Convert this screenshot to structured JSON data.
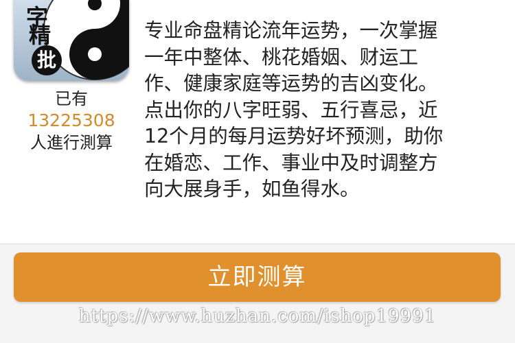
{
  "app_icon": {
    "chars": [
      "字",
      "精"
    ],
    "badge": "批",
    "icon": "yin-yang-icon"
  },
  "stats": {
    "prefix": "已有",
    "count": "13225308",
    "suffix": "人進行測算"
  },
  "description": {
    "lines": [
      "专业命盘精论流年运势，一次掌握",
      "一年中整体、桃花婚姻、财运工",
      "作、健康家庭等运势的吉凶变化。",
      "点出你的八字旺弱、五行喜忌，近",
      "12个月的每月运势好坏预测，助你",
      "在婚恋、工作、事业中及时调整方",
      "向大展身手，如鱼得水。"
    ]
  },
  "cta": {
    "label": "立即测算"
  },
  "watermark": {
    "text": "https://www.huzhan.com/ishop19991"
  },
  "colors": {
    "accent": "#e0912e",
    "count": "#d18a2c"
  }
}
